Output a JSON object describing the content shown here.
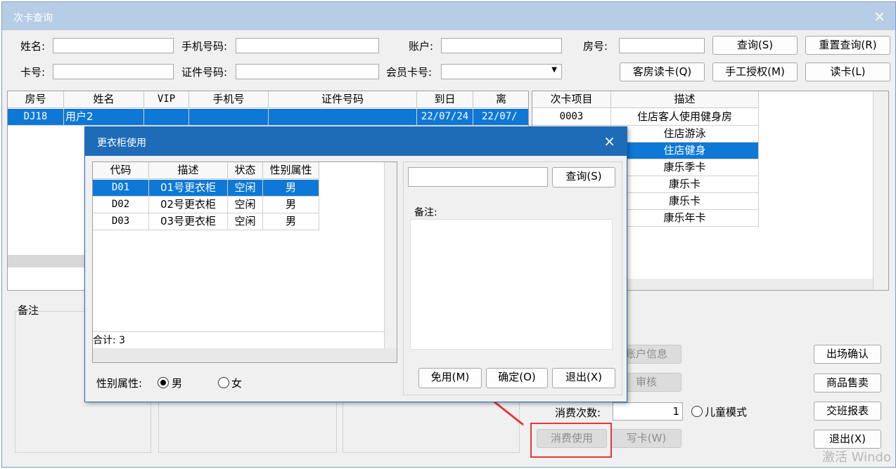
{
  "main": {
    "title": "次卡查询",
    "close": "×",
    "search": {
      "name_label": "姓名:",
      "phone_label": "手机号码:",
      "account_label": "账户:",
      "room_label": "房号:",
      "card_label": "卡号:",
      "idcard_label": "证件号码:",
      "member_label": "会员卡号:"
    },
    "buttons": {
      "query": "查询(S)",
      "reset": "重置查询(R)",
      "room_read": "客房读卡(Q)",
      "manual_auth": "手工授权(M)",
      "read_card": "读卡(L)",
      "exit_confirm": "出场确认",
      "goods_sale": "商品售卖",
      "shift_report": "交班报表",
      "exit": "退出(X)",
      "account_info": "账户信息",
      "audit": "审核",
      "consume": "消费使用",
      "write_card": "写卡(W)"
    },
    "guest_table": {
      "headers": [
        "房号",
        "姓名",
        "VIP",
        "手机号",
        "证件号码",
        "到日",
        "离"
      ],
      "rows": [
        [
          "DJ18",
          "用户2",
          "",
          "",
          "",
          "22/07/24",
          "22/07/"
        ]
      ]
    },
    "item_table": {
      "headers": [
        "次卡项目",
        "描述"
      ],
      "rows": [
        [
          "0003",
          "住店客人使用健身房"
        ],
        [
          "",
          "住店游泳"
        ],
        [
          "",
          "住店健身"
        ],
        [
          "",
          "康乐季卡"
        ],
        [
          "",
          "康乐卡"
        ],
        [
          "",
          "康乐卡"
        ],
        [
          "",
          "康乐年卡"
        ]
      ]
    },
    "remark_label": "备注",
    "count_label": "消费次数:",
    "count_value": "1",
    "kid_mode": "儿童模式",
    "watermark": "激活 Windo"
  },
  "dialog": {
    "title": "更衣柜使用",
    "close": "×",
    "table": {
      "headers": [
        "代码",
        "描述",
        "状态",
        "性别属性"
      ],
      "rows": [
        [
          "D01",
          "01号更衣柜",
          "空闲",
          "男"
        ],
        [
          "D02",
          "02号更衣柜",
          "空闲",
          "男"
        ],
        [
          "D03",
          "03号更衣柜",
          "空闲",
          "男"
        ]
      ]
    },
    "total": "合计: 3",
    "search_btn": "查询(S)",
    "remark_label": "备注:",
    "gender_label": "性别属性:",
    "male": "男",
    "female": "女",
    "free_btn": "免用(M)",
    "ok_btn": "确定(O)",
    "exit_btn": "退出(X)"
  },
  "colors": {
    "selection": "#0e78d7",
    "dialog_title": "#1e6cb8",
    "highlight_box": "#e53935"
  }
}
